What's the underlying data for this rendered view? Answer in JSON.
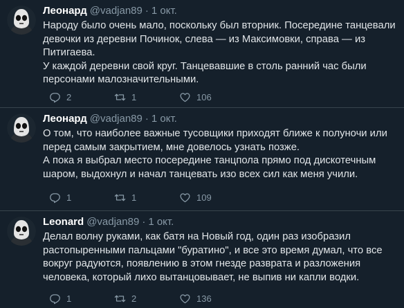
{
  "tweets": [
    {
      "name": "Леонард",
      "handle": "@vadjan89",
      "dot": "·",
      "date": "1 окт.",
      "paragraphs": [
        "Народу было очень мало, поскольку был вторник. Посередине танцевали девочки из деревни Починок, слева — из Максимовки, справа — из Питигаева.",
        "У каждой деревни свой круг. Танцевавшие в столь ранний час были персонами малозначительными."
      ],
      "replies": "2",
      "retweets": "1",
      "likes": "106"
    },
    {
      "name": "Леонард",
      "handle": "@vadjan89",
      "dot": "·",
      "date": "1 окт.",
      "paragraphs": [
        "О том, что наиболее важные тусовщики приходят ближе к полуночи или перед самым закрытием, мне довелось узнать позже.",
        "А пока я выбрал место посередине танцпола прямо под дискотечным шаром, выдохнул и начал танцевать изо всех сил как меня учили."
      ],
      "replies": "1",
      "retweets": "1",
      "likes": "109"
    },
    {
      "name": "Leonard",
      "handle": "@vadjan89",
      "dot": "·",
      "date": "1 окт.",
      "paragraphs": [
        "Делал волну руками, как батя на Новый год, один раз изобразил растопыренными пальцами \"буратино\", и все это время думал,  что все вокруг радуются, появлению в этом гнезде разврата и разложения человека, который лихо вытанцовывает, не выпив ни капли водки."
      ],
      "replies": "1",
      "retweets": "2",
      "likes": "136"
    }
  ],
  "icons": {
    "reply": "reply-icon",
    "retweet": "retweet-icon",
    "like": "heart-icon",
    "avatar": "masked-face-avatar"
  },
  "colors": {
    "background": "#15202b",
    "text": "#e1e5e8",
    "secondary": "#8899a6",
    "divider": "#38444d"
  }
}
